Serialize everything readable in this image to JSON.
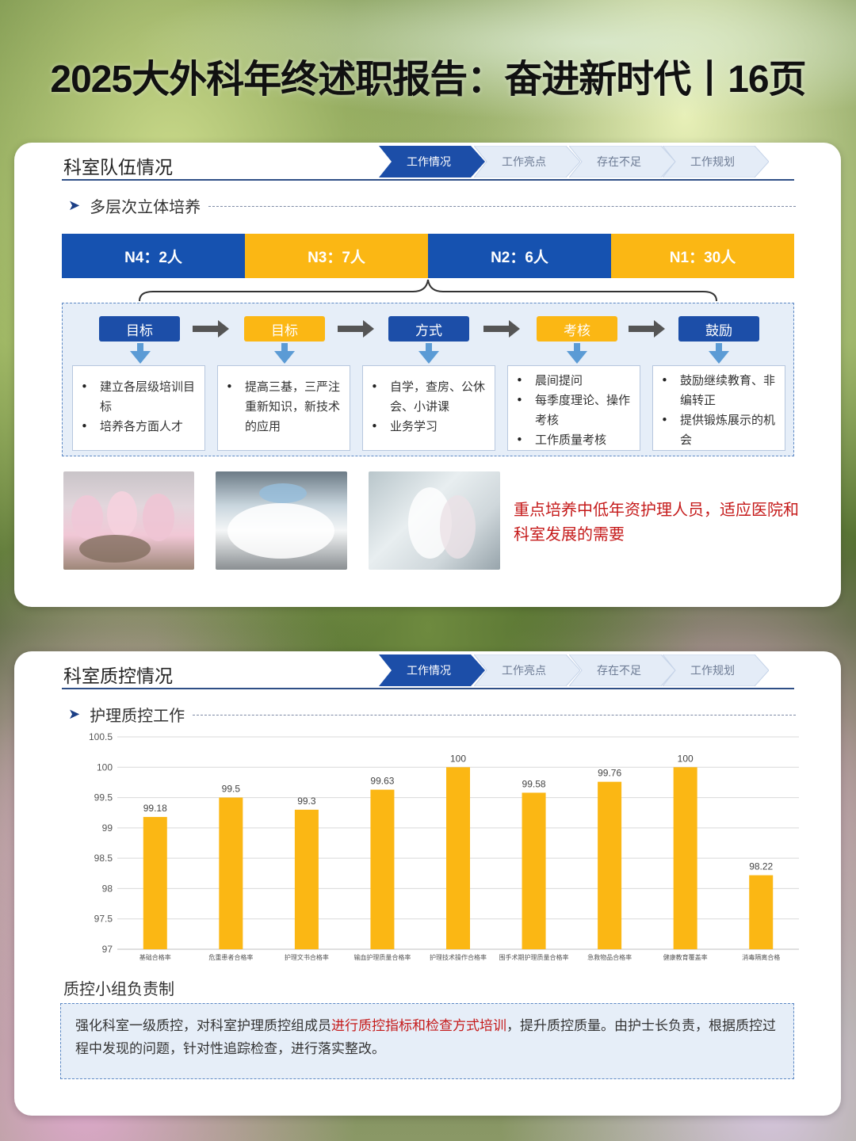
{
  "page": {
    "title": "2025大外科年终述职报告：奋进新时代丨16页"
  },
  "nav_tabs": [
    {
      "label": "工作情况",
      "active": true
    },
    {
      "label": "工作亮点",
      "active": false
    },
    {
      "label": "存在不足",
      "active": false
    },
    {
      "label": "工作规划",
      "active": false
    }
  ],
  "section1": {
    "title": "科室队伍情况",
    "subheading": "多层次立体培养",
    "levels": [
      {
        "label": "N4：2人",
        "color": "blue"
      },
      {
        "label": "N3：7人",
        "color": "gold"
      },
      {
        "label": "N2：6人",
        "color": "blue"
      },
      {
        "label": "N1：30人",
        "color": "gold"
      }
    ],
    "steps": [
      {
        "label": "目标",
        "color": "blue",
        "items": [
          "建立各层级培训目标",
          "培养各方面人才"
        ]
      },
      {
        "label": "目标",
        "color": "gold",
        "items": [
          "提高三基，三严注重新知识，新技术的应用"
        ]
      },
      {
        "label": "方式",
        "color": "blue",
        "items": [
          "自学，查房、公休会、小讲课",
          "业务学习"
        ]
      },
      {
        "label": "考核",
        "color": "gold",
        "items": [
          "晨间提问",
          "每季度理论、操作考核",
          "工作质量考核"
        ]
      },
      {
        "label": "鼓励",
        "color": "blue",
        "items": [
          "鼓励继续教育、非编转正",
          "提供锻炼展示的机会"
        ]
      }
    ],
    "emphasis": "重点培养中低年资护理人员，适应医院和科室发展的需要"
  },
  "section2": {
    "title": "科室质控情况",
    "subheading": "护理质控工作",
    "qc_title": "质控小组负责制",
    "qc_text_before": "强化科室一级质控，对科室护理质控组成员",
    "qc_text_highlight": "进行质控指标和检查方式培训",
    "qc_text_after": "，提升质控质量。由护士长负责，根据质控过程中发现的问题，针对性追踪检查，进行落实整改。"
  },
  "colors": {
    "blue": "#1652b0",
    "gold": "#fbb714",
    "red": "#c51a1a",
    "nav_blue": "#1c4ea8"
  },
  "chart_data": {
    "type": "bar",
    "categories": [
      "基础合格率",
      "危重患者合格率",
      "护理文书合格率",
      "输血护理质量合格率",
      "护理技术操作合格率",
      "围手术期护理质量合格率",
      "急救物品合格率",
      "健康教育覆盖率",
      "消毒隔离合格"
    ],
    "values": [
      99.18,
      99.5,
      99.3,
      99.63,
      100,
      99.58,
      99.76,
      100,
      98.22
    ],
    "ylim": [
      97,
      100.5
    ],
    "yticks": [
      97,
      97.5,
      98,
      98.5,
      99,
      99.5,
      100,
      100.5
    ],
    "grid": true,
    "bar_color": "#fbb714"
  }
}
